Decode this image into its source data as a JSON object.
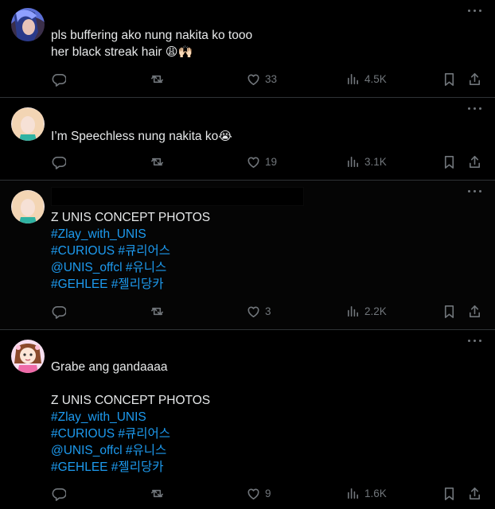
{
  "tweets": [
    {
      "lines": [
        {
          "parts": [
            {
              "t": "pls buffering ako nung nakita ko tooo",
              "link": false
            }
          ]
        },
        {
          "parts": [
            {
              "t": "her black streak hair ",
              "link": false
            },
            {
              "t": "😩🙌🏻",
              "link": false,
              "emoji": true
            }
          ]
        }
      ],
      "likes": "33",
      "views": "4.5K",
      "avatar": "avatar-blue-hair"
    },
    {
      "lines": [
        {
          "parts": [
            {
              "t": "I’m Speechless nung nakita ko",
              "link": false
            },
            {
              "t": "😭",
              "link": false,
              "emoji": true
            }
          ]
        }
      ],
      "likes": "19",
      "views": "3.1K",
      "avatar": "avatar-blonde"
    },
    {
      "lines": [
        {
          "parts": [
            {
              "t": "Z UNIS CONCEPT PHOTOS",
              "link": false
            }
          ]
        },
        {
          "parts": [
            {
              "t": "#Zlay_with_UNIS",
              "link": true
            }
          ]
        },
        {
          "parts": [
            {
              "t": "#CURIOUS #큐리어스",
              "link": true
            }
          ]
        },
        {
          "parts": [
            {
              "t": "@UNIS_offcl #유니스",
              "link": true
            }
          ]
        },
        {
          "parts": [
            {
              "t": "#GEHLEE #젤리당카",
              "link": true
            }
          ]
        }
      ],
      "likes": "3",
      "views": "2.2K",
      "avatar": "avatar-blonde"
    },
    {
      "lines": [
        {
          "parts": [
            {
              "t": "Grabe ang gandaaaa",
              "link": false
            }
          ]
        },
        {
          "gap": true
        },
        {
          "parts": [
            {
              "t": "Z UNIS CONCEPT PHOTOS",
              "link": false
            }
          ]
        },
        {
          "parts": [
            {
              "t": "#Zlay_with_UNIS",
              "link": true
            }
          ]
        },
        {
          "parts": [
            {
              "t": "#CURIOUS #큐리어스",
              "link": true
            }
          ]
        },
        {
          "parts": [
            {
              "t": "@UNIS_offcl #유니스",
              "link": true
            }
          ]
        },
        {
          "parts": [
            {
              "t": "#GEHLEE #젤리당카",
              "link": true
            }
          ]
        }
      ],
      "likes": "9",
      "views": "1.6K",
      "avatar": "avatar-cartoon-girl"
    }
  ],
  "colors": {
    "background": "#000000",
    "text": "#e7e9ea",
    "link": "#1d9bf0",
    "muted": "#71767b",
    "divider": "#2f3336"
  },
  "icons": [
    "reply-icon",
    "retweet-icon",
    "like-icon",
    "views-icon",
    "bookmark-icon",
    "share-icon",
    "more-icon"
  ]
}
